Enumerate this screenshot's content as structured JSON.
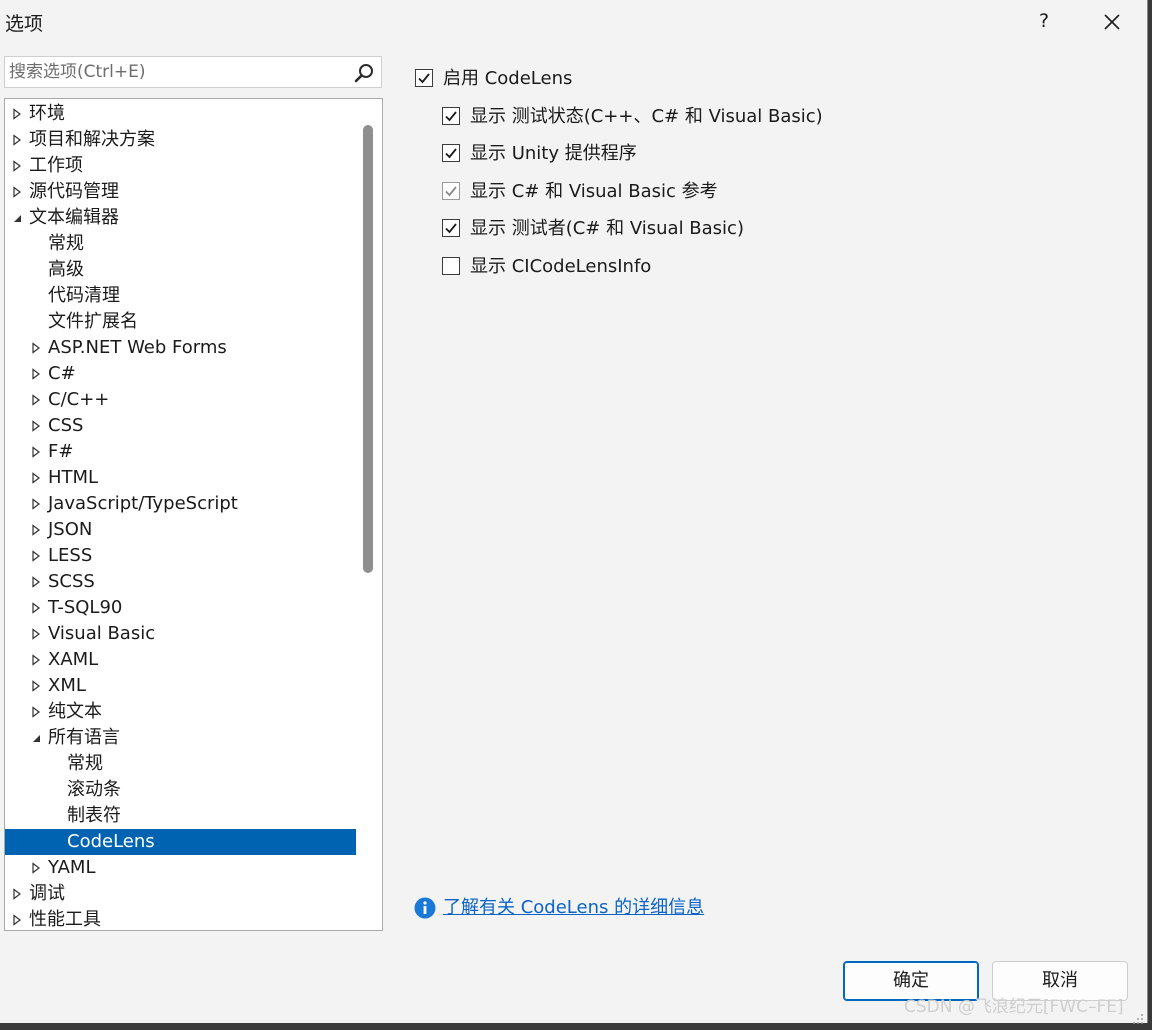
{
  "window": {
    "title": "选项",
    "help_label": "?",
    "close_icon": "close-icon"
  },
  "search": {
    "placeholder": "搜索选项(Ctrl+E)",
    "value": "",
    "icon": "search-icon"
  },
  "tree": {
    "items": [
      {
        "label": "环境",
        "level": 0,
        "expander": "collapsed",
        "selected": false
      },
      {
        "label": "项目和解决方案",
        "level": 0,
        "expander": "collapsed",
        "selected": false
      },
      {
        "label": "工作项",
        "level": 0,
        "expander": "collapsed",
        "selected": false
      },
      {
        "label": "源代码管理",
        "level": 0,
        "expander": "collapsed",
        "selected": false
      },
      {
        "label": "文本编辑器",
        "level": 0,
        "expander": "expanded",
        "selected": false
      },
      {
        "label": "常规",
        "level": 1,
        "expander": "none",
        "selected": false
      },
      {
        "label": "高级",
        "level": 1,
        "expander": "none",
        "selected": false
      },
      {
        "label": "代码清理",
        "level": 1,
        "expander": "none",
        "selected": false
      },
      {
        "label": "文件扩展名",
        "level": 1,
        "expander": "none",
        "selected": false
      },
      {
        "label": "ASP.NET Web Forms",
        "level": 1,
        "expander": "collapsed",
        "selected": false
      },
      {
        "label": "C#",
        "level": 1,
        "expander": "collapsed",
        "selected": false
      },
      {
        "label": "C/C++",
        "level": 1,
        "expander": "collapsed",
        "selected": false
      },
      {
        "label": "CSS",
        "level": 1,
        "expander": "collapsed",
        "selected": false
      },
      {
        "label": "F#",
        "level": 1,
        "expander": "collapsed",
        "selected": false
      },
      {
        "label": "HTML",
        "level": 1,
        "expander": "collapsed",
        "selected": false
      },
      {
        "label": "JavaScript/TypeScript",
        "level": 1,
        "expander": "collapsed",
        "selected": false
      },
      {
        "label": "JSON",
        "level": 1,
        "expander": "collapsed",
        "selected": false
      },
      {
        "label": "LESS",
        "level": 1,
        "expander": "collapsed",
        "selected": false
      },
      {
        "label": "SCSS",
        "level": 1,
        "expander": "collapsed",
        "selected": false
      },
      {
        "label": "T-SQL90",
        "level": 1,
        "expander": "collapsed",
        "selected": false
      },
      {
        "label": "Visual Basic",
        "level": 1,
        "expander": "collapsed",
        "selected": false
      },
      {
        "label": "XAML",
        "level": 1,
        "expander": "collapsed",
        "selected": false
      },
      {
        "label": "XML",
        "level": 1,
        "expander": "collapsed",
        "selected": false
      },
      {
        "label": "纯文本",
        "level": 1,
        "expander": "collapsed",
        "selected": false
      },
      {
        "label": "所有语言",
        "level": 1,
        "expander": "expanded",
        "selected": false
      },
      {
        "label": "常规",
        "level": 2,
        "expander": "none",
        "selected": false
      },
      {
        "label": "滚动条",
        "level": 2,
        "expander": "none",
        "selected": false
      },
      {
        "label": "制表符",
        "level": 2,
        "expander": "none",
        "selected": false
      },
      {
        "label": "CodeLens",
        "level": 2,
        "expander": "none",
        "selected": true
      },
      {
        "label": "YAML",
        "level": 1,
        "expander": "collapsed",
        "selected": false
      },
      {
        "label": "调试",
        "level": 0,
        "expander": "collapsed",
        "selected": false
      },
      {
        "label": "性能工具",
        "level": 0,
        "expander": "collapsed",
        "selected": false
      }
    ]
  },
  "options": [
    {
      "label": "启用 CodeLens",
      "checked": true,
      "disabled": false,
      "indent": 0
    },
    {
      "label": "显示 测试状态(C++、C# 和 Visual Basic)",
      "checked": true,
      "disabled": false,
      "indent": 1
    },
    {
      "label": "显示 Unity 提供程序",
      "checked": true,
      "disabled": false,
      "indent": 1
    },
    {
      "label": "显示 C# 和 Visual Basic 参考",
      "checked": true,
      "disabled": true,
      "indent": 1
    },
    {
      "label": "显示 测试者(C# 和 Visual Basic)",
      "checked": true,
      "disabled": false,
      "indent": 1
    },
    {
      "label": "显示 CICodeLensInfo",
      "checked": false,
      "disabled": false,
      "indent": 1
    }
  ],
  "info": {
    "icon": "info-icon",
    "link_text": "了解有关 CodeLens 的详细信息"
  },
  "buttons": {
    "ok": "确定",
    "cancel": "取消"
  },
  "watermark": "CSDN @飞浪纪元[FWC–FE]",
  "colors": {
    "selection": "#0063b1",
    "link": "#0a63c9",
    "dialog_bg": "#f3f3f3",
    "primary_border": "#0067c0"
  }
}
